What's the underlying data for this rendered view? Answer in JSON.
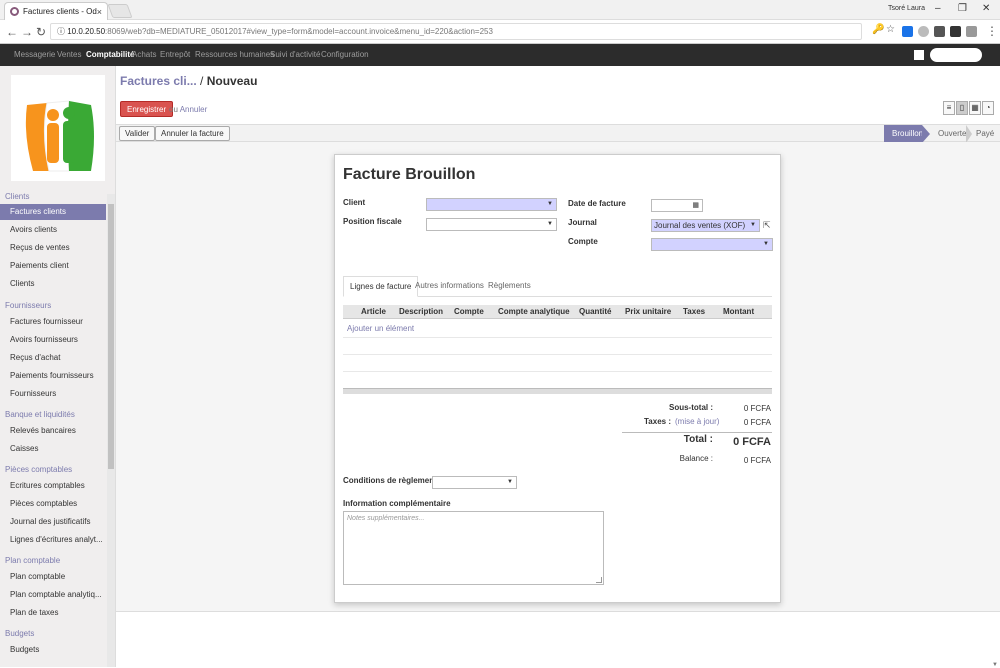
{
  "browser": {
    "tab_title": "Factures clients - Odoo",
    "tab_close": "×",
    "user": "Tsoré Laura",
    "url_host": "10.0.20.50",
    "url_path": ":8069/web?db=MEDIATURE_05012017#view_type=form&model=account.invoice&menu_id=220&action=253"
  },
  "topmenu": {
    "items": [
      "Messagerie",
      "Ventes",
      "Comptabilité",
      "Achats",
      "Entrepôt",
      "Ressources humaines",
      "Suivi d'activité",
      "Configuration"
    ],
    "active_index": 2
  },
  "sidebar": {
    "sections": [
      {
        "title": "Clients",
        "items": [
          "Factures clients",
          "Avoirs clients",
          "Reçus de ventes",
          "Paiements client",
          "Clients"
        ]
      },
      {
        "title": "Fournisseurs",
        "items": [
          "Factures fournisseur",
          "Avoirs fournisseurs",
          "Reçus d'achat",
          "Paiements fournisseurs",
          "Fournisseurs"
        ]
      },
      {
        "title": "Banque et liquidités",
        "items": [
          "Relevés bancaires",
          "Caisses"
        ]
      },
      {
        "title": "Pièces comptables",
        "items": [
          "Ecritures comptables",
          "Pièces comptables",
          "Journal des justificatifs",
          "Lignes d'écritures analyt..."
        ]
      },
      {
        "title": "Plan comptable",
        "items": [
          "Plan comptable",
          "Plan comptable analytiq...",
          "Plan de taxes"
        ]
      },
      {
        "title": "Budgets",
        "items": [
          "Budgets"
        ]
      }
    ],
    "active_item": "Factures clients"
  },
  "breadcrumb": {
    "parent": "Factures cli...",
    "separator": "/",
    "current": "Nouveau"
  },
  "actions": {
    "save": "Enregistrer",
    "or": "ou",
    "discard": "Annuler"
  },
  "statusbar": {
    "validate": "Valider",
    "cancel_invoice": "Annuler la facture",
    "stages": [
      "Brouillon",
      "Ouverte",
      "Payé"
    ],
    "active_stage": "Brouillon"
  },
  "form": {
    "title": "Facture Brouillon",
    "client_label": "Client",
    "fiscal_position_label": "Position fiscale",
    "invoice_date_label": "Date de facture",
    "journal_label": "Journal",
    "journal_value": "Journal des ventes (XOF)",
    "account_label": "Compte",
    "tabs": [
      "Lignes de facture",
      "Autres informations",
      "Règlements"
    ],
    "columns": [
      "Article",
      "Description",
      "Compte",
      "Compte analytique",
      "Quantité",
      "Prix unitaire",
      "Taxes",
      "Montant"
    ],
    "add_line": "Ajouter un élément",
    "subtotal_label": "Sous-total :",
    "subtotal_value": "0 FCFA",
    "taxes_label": "Taxes :",
    "taxes_update": "(mise à jour)",
    "taxes_value": "0 FCFA",
    "total_label": "Total :",
    "total_value": "0 FCFA",
    "balance_label": "Balance :",
    "balance_value": "0 FCFA",
    "payment_terms_label": "Conditions de règlement",
    "extra_info_label": "Information complémentaire",
    "notes_placeholder": "Notes supplémentaires..."
  },
  "colors": {
    "accent": "#7c7bad",
    "save": "#d9534f",
    "required": "#d2d2ff",
    "topbar": "#2c2c2c"
  }
}
